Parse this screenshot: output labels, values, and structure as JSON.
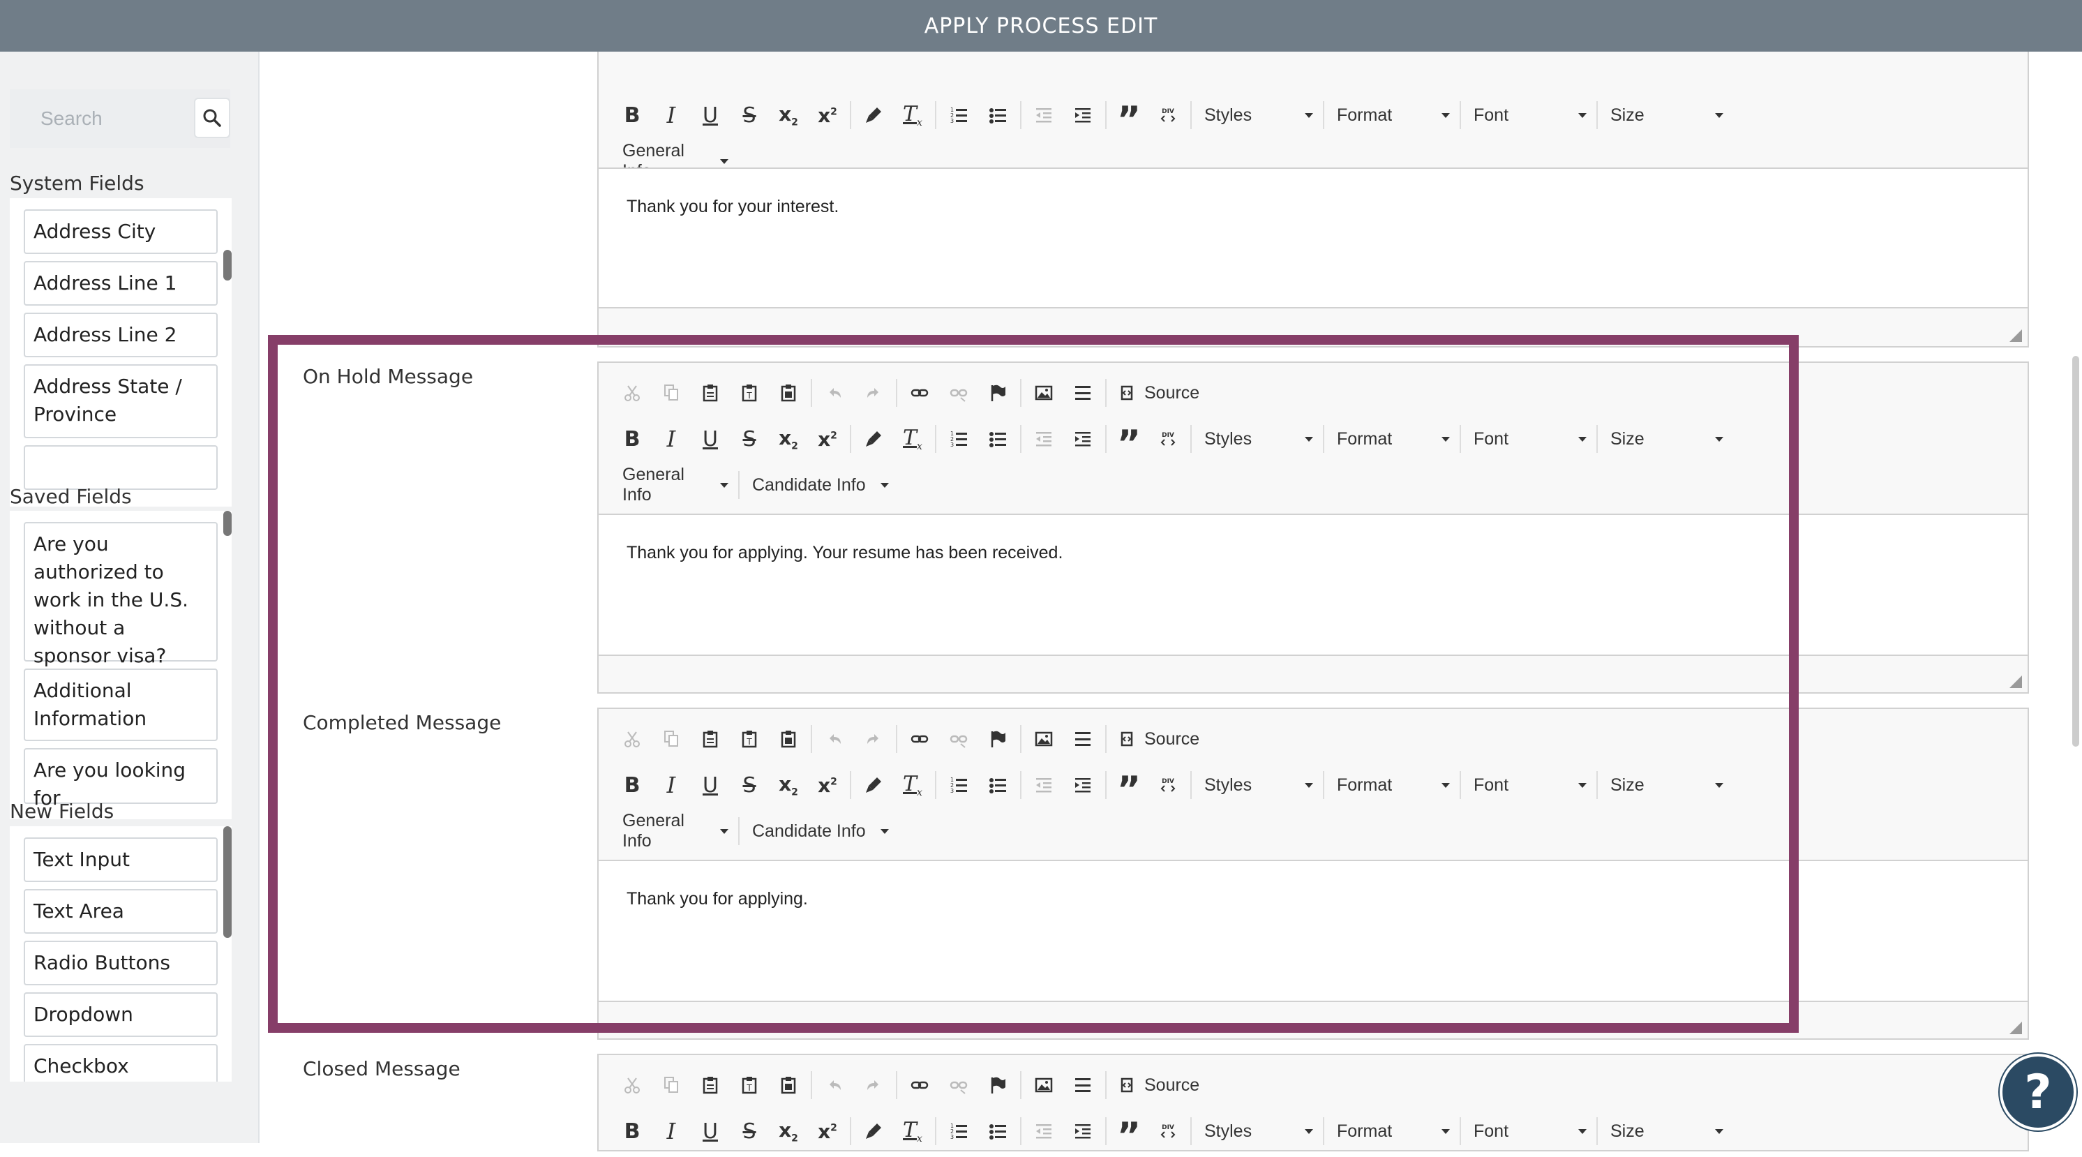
{
  "header": {
    "title": "APPLY PROCESS EDIT"
  },
  "sidebar": {
    "search": {
      "placeholder": "Search"
    },
    "system_fields": {
      "title": "System Fields",
      "items": [
        "Address City",
        "Address Line 1",
        "Address Line 2",
        "Address State / Province"
      ]
    },
    "saved_fields": {
      "title": "Saved Fields",
      "items": [
        "Are you authorized to work in the U.S. without a sponsor visa?",
        "Additional Information",
        "Are you looking for"
      ]
    },
    "new_fields": {
      "title": "New Fields",
      "items": [
        "Text Input",
        "Text Area",
        "Radio Buttons",
        "Dropdown",
        "Checkbox"
      ]
    }
  },
  "toolbar": {
    "source_label": "Source",
    "styles_label": "Styles",
    "format_label": "Format",
    "font_label": "Font",
    "size_label": "Size",
    "general_info_label": "General Info",
    "candidate_info_label": "Candidate Info"
  },
  "editors": {
    "top": {
      "content": "Thank you for your interest."
    },
    "on_hold": {
      "label": "On Hold Message",
      "content": "Thank you for applying. Your resume has been received."
    },
    "completed": {
      "label": "Completed Message",
      "content": "Thank you for applying."
    },
    "closed": {
      "label": "Closed Message"
    }
  },
  "colors": {
    "header_bg": "#707d88",
    "highlight_border": "#863e68",
    "help_button_bg": "#2b4a63"
  },
  "help": {
    "icon": "question-mark-icon",
    "glyph": "?"
  }
}
